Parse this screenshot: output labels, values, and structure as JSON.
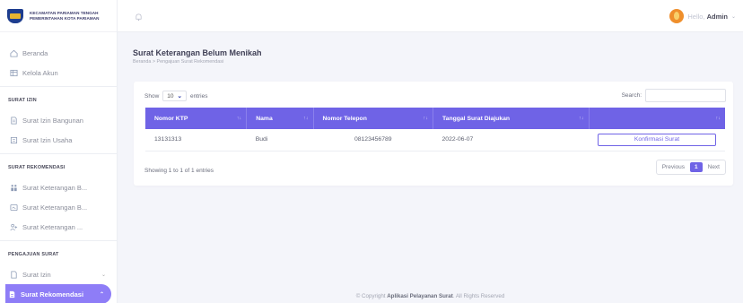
{
  "brand": {
    "line1": "KECAMATAN PARIAMAN TENGAH",
    "line2": "PEMERINTAHAN KOTA PARIAMAN"
  },
  "sidebar": {
    "beranda": "Beranda",
    "kelola_akun": "Kelola Akun",
    "section_surat_izin": "SURAT IZIN",
    "izin_bangunan": "Surat Izin Bangunan",
    "izin_usaha": "Surat Izin Usaha",
    "section_rekomendasi": "SURAT REKOMENDASI",
    "ket_b1": "Surat Keterangan B...",
    "ket_b2": "Surat Keterangan B...",
    "ket_3": "Surat Keterangan ...",
    "section_pengajuan": "PENGAJUAN SURAT",
    "surat_izin": "Surat Izin",
    "surat_rekomendasi": "Surat Rekomendasi"
  },
  "topbar": {
    "greeting": "Hello, ",
    "user": "Admin"
  },
  "page": {
    "title": "Surat Keterangan Belum Menikah",
    "breadcrumb": "Beranda > Pengajuan Surat Rekomendasi"
  },
  "table": {
    "show_label": "Show",
    "show_value": "10",
    "entries_label": "entries",
    "search_label": "Search:",
    "columns": [
      "Nomor KTP",
      "Nama",
      "Nomor Telepon",
      "Tanggal Surat Diajukan",
      ""
    ],
    "rows": [
      {
        "ktp": "13131313",
        "nama": "Budi",
        "telepon": "08123456789",
        "tanggal": "2022-06-07",
        "action": "Konfirmasi Surat"
      }
    ],
    "info": "Showing 1 to 1 of 1 entries",
    "prev": "Previous",
    "page": "1",
    "next": "Next"
  },
  "footer": {
    "prefix": "© Copyright ",
    "app": "Aplikasi Pelayanan Surat",
    "suffix": ". All Rights Reserved"
  },
  "colors": {
    "accent": "#6f63e6",
    "active_nav": "#8e7df7"
  }
}
